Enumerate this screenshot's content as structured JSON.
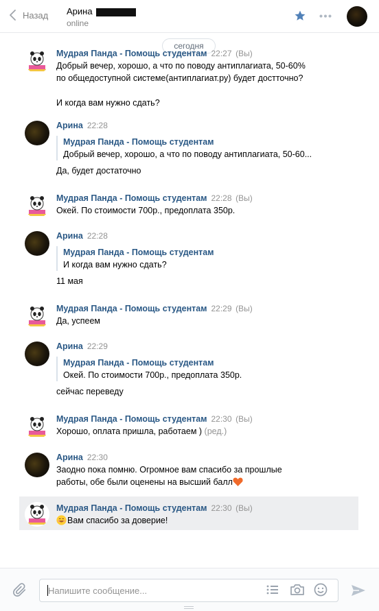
{
  "header": {
    "back_label": "Назад",
    "peer_name": "Арина",
    "peer_status": "online"
  },
  "date_divider": "сегодня",
  "messages": [
    {
      "author": "Мудрая Панда - Помощь студентам",
      "time": "22:27",
      "tag": "(Вы)",
      "text_lines": [
        "Добрый вечер, хорошо, а что по поводу антиплагиата, 50-60%",
        "по общедоступной системе(антиплагиат.ру) будет достточно?",
        "",
        "И когда вам нужно сдать?"
      ]
    },
    {
      "author": "Арина",
      "time": "22:28",
      "forward_author": "Мудрая Панда - Помощь студентам",
      "forward_text": "Добрый вечер, хорошо, а что по поводу антиплагиата, 50-60...",
      "text": "Да, будет достаточно"
    },
    {
      "author": "Мудрая Панда - Помощь студентам",
      "time": "22:28",
      "tag": "(Вы)",
      "text": "Окей. По стоимости 700р., предоплата 350р."
    },
    {
      "author": "Арина",
      "time": "22:28",
      "forward_author": "Мудрая Панда - Помощь студентам",
      "forward_text": "И когда вам нужно сдать?",
      "text": "11 мая"
    },
    {
      "author": "Мудрая Панда - Помощь студентам",
      "time": "22:29",
      "tag": "(Вы)",
      "text": "Да, успеем"
    },
    {
      "author": "Арина",
      "time": "22:29",
      "forward_author": "Мудрая Панда - Помощь студентам",
      "forward_text": "Окей. По стоимости 700р., предоплата 350р.",
      "text": "сейчас переведу"
    },
    {
      "author": "Мудрая Панда - Помощь студентам",
      "time": "22:30",
      "tag": "(Вы)",
      "text": "Хорошо, оплата пришла, работаем )",
      "edited": "(ред.)"
    },
    {
      "author": "Арина",
      "time": "22:30",
      "text_lines": [
        "Заодно пока помню. Огромное вам спасибо за прошлые",
        "работы, обе были оценены на высший балл"
      ],
      "emoji": "heart"
    },
    {
      "author": "Мудрая Панда - Помощь студентам",
      "time": "22:30",
      "tag": "(Вы)",
      "text": "Вам спасибо за доверие!",
      "emoji": "smile"
    }
  ],
  "composer": {
    "placeholder": "Напишите сообщение..."
  },
  "colors": {
    "link_blue": "#2a5885",
    "accent_blue": "#5181b8",
    "muted_gray": "#939393",
    "highlight_bg": "#edeef0"
  },
  "icons": [
    "back-chevron-icon",
    "star-icon",
    "more-dots-icon",
    "paperclip-icon",
    "list-icon",
    "camera-icon",
    "emoji-smile-icon",
    "send-icon"
  ]
}
